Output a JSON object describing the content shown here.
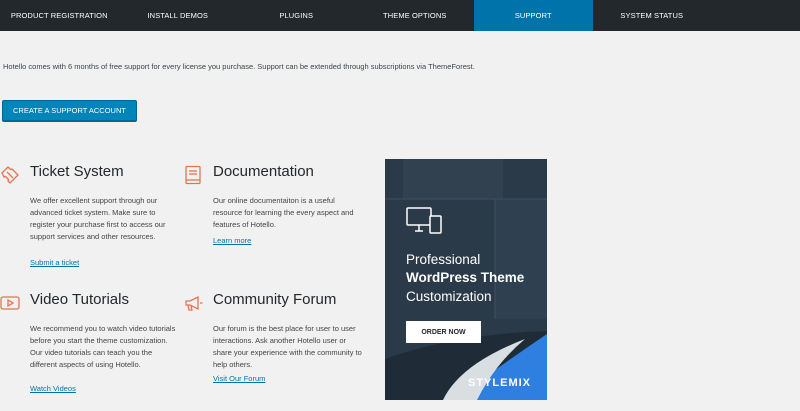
{
  "tabs": [
    {
      "label": "Product Registration"
    },
    {
      "label": "Install Demos"
    },
    {
      "label": "Plugins"
    },
    {
      "label": "Theme Options"
    },
    {
      "label": "Support"
    },
    {
      "label": "System Status"
    }
  ],
  "active_tab": "Support",
  "intro_text": "Hotello comes with 6 months of free support for every license you purchase. Support can be extended through subscriptions via ThemeForest.",
  "create_button": "Create a Support Account",
  "cards": {
    "ticket": {
      "title": "Ticket System",
      "icon": "ticket-icon",
      "description": "We offer excellent support through our advanced ticket system. Make sure to register your purchase first to access our support services and other resources.",
      "link": "Submit a ticket"
    },
    "documentation": {
      "title": "Documentation",
      "icon": "book-icon",
      "description": "Our online documentaiton is a useful resource for learning the every aspect and features of Hotello.",
      "link": "Learn more"
    },
    "video": {
      "title": "Video Tutorials",
      "icon": "video-play-icon",
      "description": "We recommend you to watch video tutorials before you start the theme customization. Our video tutorials can teach you the different aspects of using Hotello.",
      "link": "Watch Videos"
    },
    "forum": {
      "title": "Community Forum",
      "icon": "megaphone-icon",
      "description": "Our forum is the best place for user to user interactions. Ask another Hotello user or share your experience with the community to help others.",
      "link": "Visit Our Forum"
    }
  },
  "banner": {
    "line1": "Professional",
    "line2": "WordPress Theme",
    "line3": "Customization",
    "button": "Order Now",
    "brand": "STYLEMIX",
    "icon": "monitor-devices-icon"
  },
  "colors": {
    "tab_bar": "#23282d",
    "active_tab": "#0073aa",
    "button": "#0085ba",
    "accent_icon": "#e4744f",
    "link": "#0073aa",
    "banner_bg": "#2b3a48",
    "banner_corner": "#2f7fe0"
  }
}
